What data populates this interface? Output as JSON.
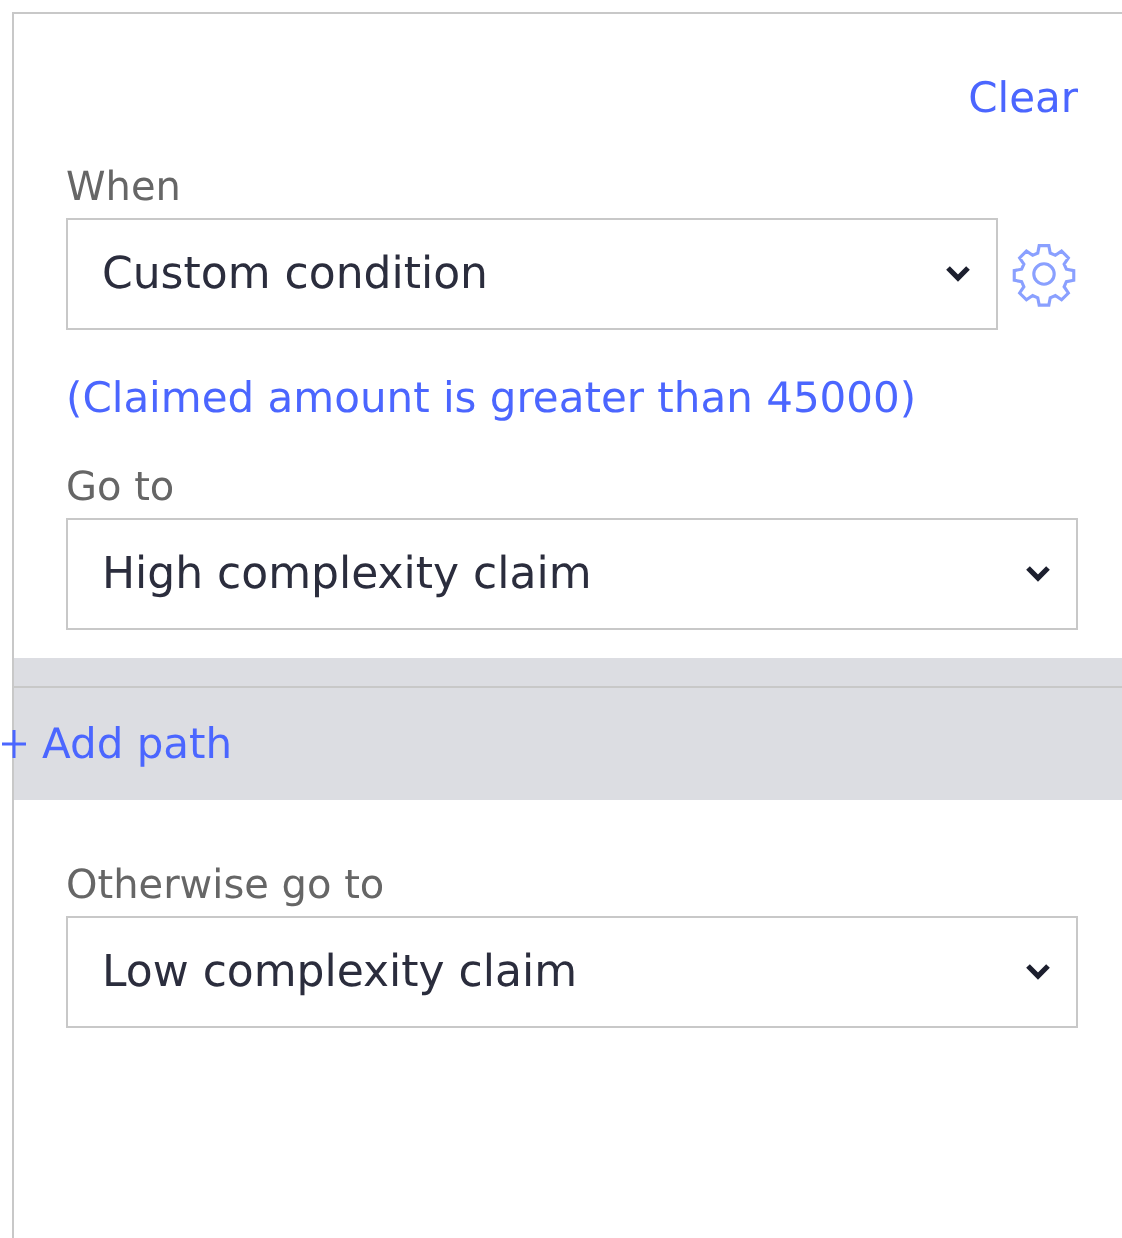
{
  "clear_link": "Clear",
  "when": {
    "label": "When",
    "value": "Custom condition"
  },
  "condition_link": "(Claimed amount is greater than 45000)",
  "go_to": {
    "label": "Go to",
    "value": "High complexity claim"
  },
  "add_path": "Add path",
  "otherwise_go_to": {
    "label": "Otherwise go to",
    "value": "Low complexity claim"
  }
}
